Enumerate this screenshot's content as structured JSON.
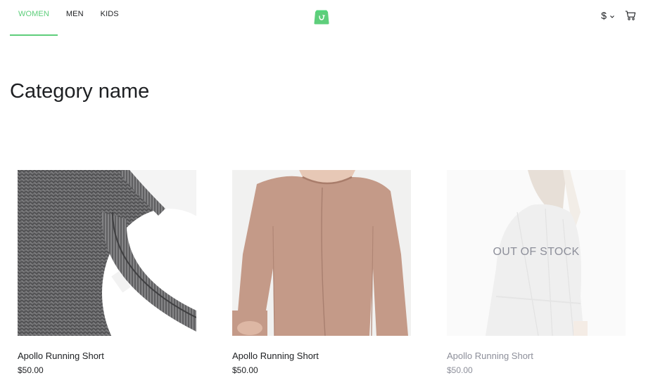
{
  "nav": {
    "items": [
      {
        "label": "WOMEN",
        "active": true
      },
      {
        "label": "MEN",
        "active": false
      },
      {
        "label": "KIDS",
        "active": false
      }
    ]
  },
  "header": {
    "logo_icon": "shopping-bag-icon",
    "currency_symbol": "$",
    "cart_icon": "cart-icon"
  },
  "colors": {
    "accent": "#5ece7b",
    "text": "#1d1f22",
    "muted": "#8d8f9a"
  },
  "category": {
    "title": "Category name"
  },
  "products": [
    {
      "name": "Apollo Running Short",
      "price": "$50.00",
      "in_stock": true,
      "image": "grey knit sweater"
    },
    {
      "name": "Apollo Running Short",
      "price": "$50.00",
      "in_stock": true,
      "image": "beige knit dress"
    },
    {
      "name": "Apollo Running Short",
      "price": "$50.00",
      "in_stock": false,
      "out_of_stock_label": "OUT OF STOCK",
      "image": "white striped wrap dress"
    }
  ]
}
